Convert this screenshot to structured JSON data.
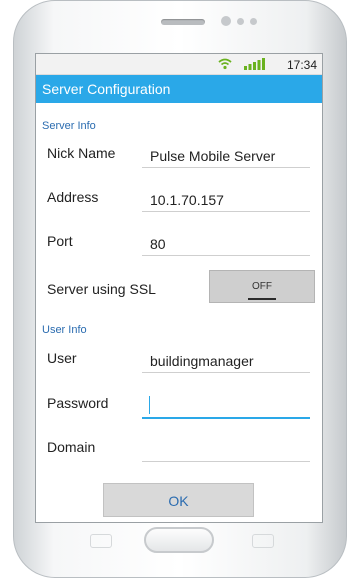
{
  "status": {
    "time": "17:34"
  },
  "title": "Server Configuration",
  "server_info": {
    "heading": "Server Info",
    "nick_name": {
      "label": "Nick Name",
      "value": "Pulse Mobile Server"
    },
    "address": {
      "label": "Address",
      "value": "10.1.70.157"
    },
    "port": {
      "label": "Port",
      "value": "80"
    },
    "ssl": {
      "label": "Server using SSL",
      "toggle": "OFF"
    }
  },
  "user_info": {
    "heading": "User Info",
    "user": {
      "label": "User",
      "value": "buildingmanager"
    },
    "password": {
      "label": "Password",
      "value": ""
    },
    "domain": {
      "label": "Domain",
      "value": ""
    }
  },
  "ok_label": "OK",
  "colors": {
    "accent": "#2aa8e8",
    "section": "#2b6cb0",
    "signal": "#6ab21f"
  }
}
